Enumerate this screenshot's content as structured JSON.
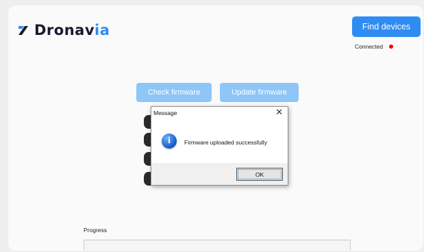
{
  "app": {
    "brand": {
      "name_main": "Dronav",
      "name_accent": "ia"
    },
    "find_devices_label": "Find devices",
    "connection": {
      "status_text": "Connected",
      "indicator_color": "#ff0000"
    },
    "check_firmware_label": "Check firmware",
    "update_firmware_label": "Update firmware",
    "progress": {
      "label": "Progress",
      "value": 0
    }
  },
  "dialog": {
    "title": "Message",
    "close_glyph": "✕",
    "icon": "info-icon",
    "message": "Firmware uploaded successfully",
    "ok_label": "OK"
  },
  "colors": {
    "accent": "#2f8cf3",
    "light_accent": "#8dc6f7",
    "status_red": "#ff0000"
  }
}
